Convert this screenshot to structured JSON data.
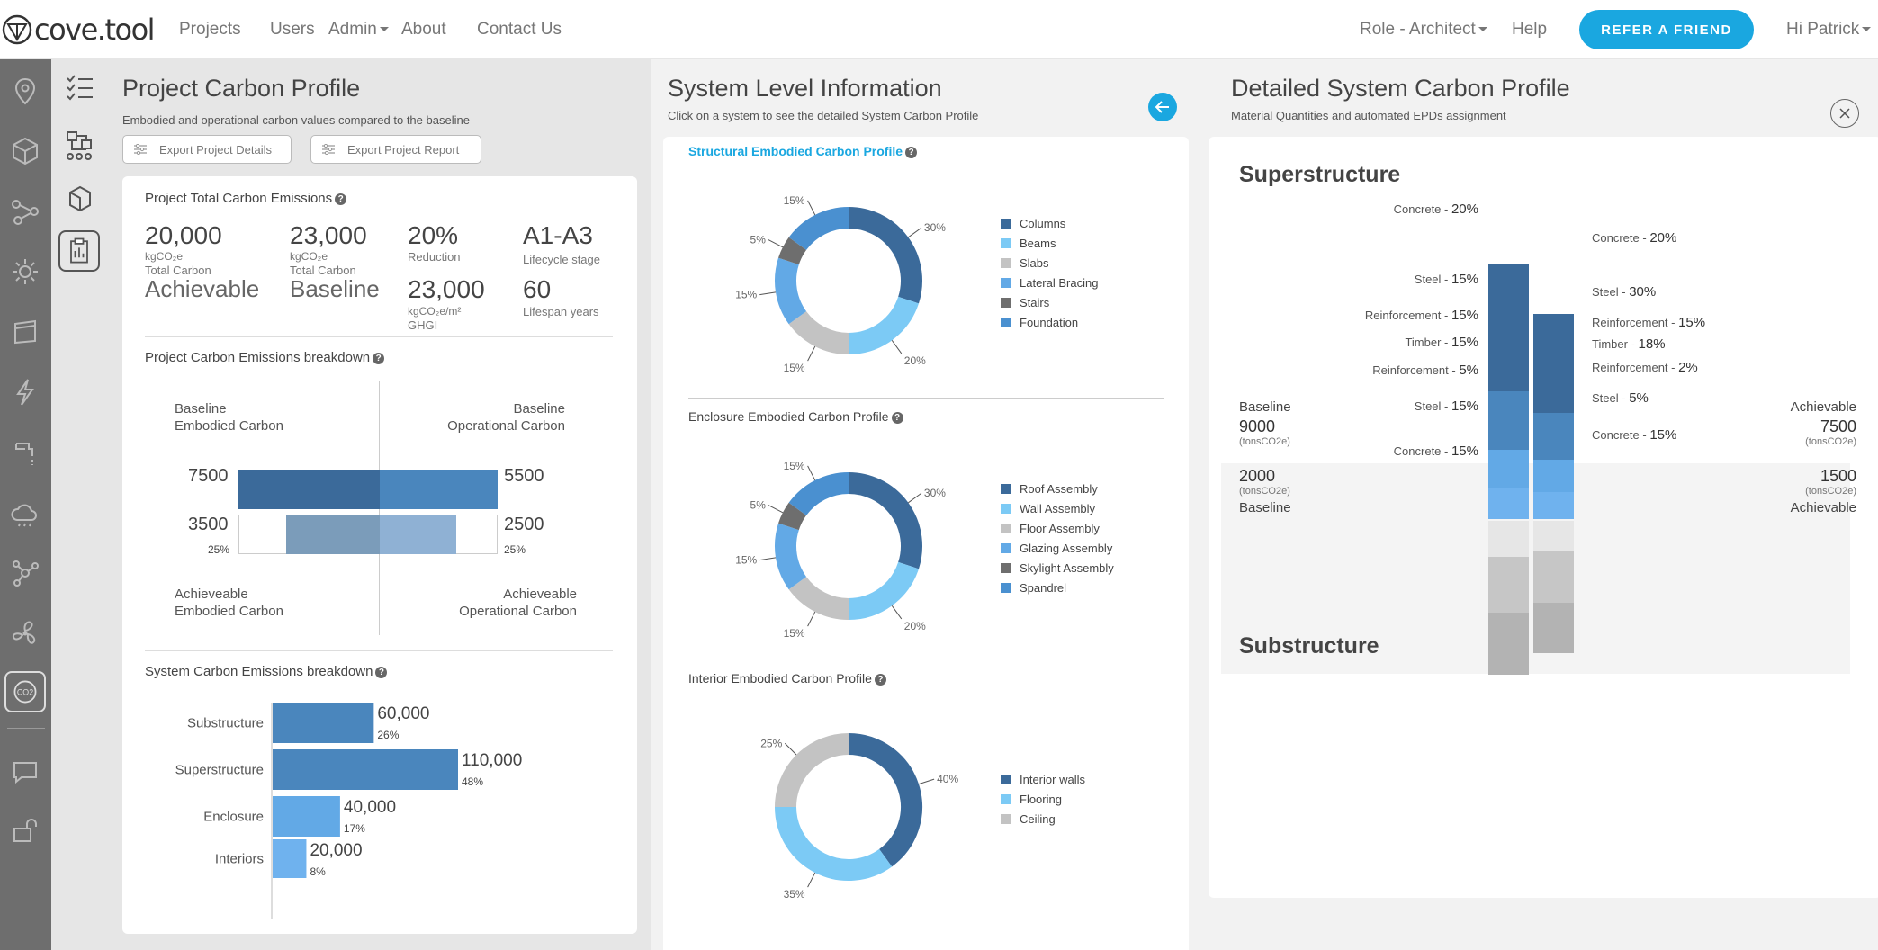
{
  "brand": {
    "logo_text": "cove.tool"
  },
  "nav": {
    "projects": "Projects",
    "users": "Users",
    "admin": "Admin",
    "about": "About",
    "contact": "Contact Us",
    "role": "Role - Architect",
    "help": "Help",
    "refer": "REFER A FRIEND",
    "greeting": "Hi Patrick"
  },
  "profile": {
    "title": "Project Carbon Profile",
    "subtitle": "Embodied and operational carbon values compared to the baseline",
    "export_details": "Export Project Details",
    "export_report": "Export Project Report",
    "total_title": "Project Total Carbon Emissions",
    "achievable_value": "20,000",
    "achievable_unit": "kgCO₂e",
    "achievable_sub": "Total Carbon",
    "achievable_label": "Achievable",
    "baseline_value": "23,000",
    "baseline_unit": "kgCO₂e",
    "baseline_sub": "Total Carbon",
    "baseline_label": "Baseline",
    "reduction_value": "20%",
    "reduction_label": "Reduction",
    "ghgi_value": "23,000",
    "ghgi_unit": "kgCO₂e/m²",
    "ghgi_label": "GHGI",
    "lifecycle_value": "A1-A3",
    "lifecycle_label": "Lifecycle stage",
    "lifespan_value": "60",
    "lifespan_label": "Lifespan years",
    "breakdown_title": "Project Carbon Emissions breakdown",
    "baseline_embodied_1": "Baseline",
    "baseline_embodied_2": "Embodied Carbon",
    "baseline_operational_1": "Baseline",
    "baseline_operational_2": "Operational Carbon",
    "achievable_embodied_1": "Achieveable",
    "achievable_embodied_2": "Embodied Carbon",
    "achievable_operational_1": "Achieveable",
    "achievable_operational_2": "Operational Carbon",
    "bl_embodied_num": "7500",
    "bl_operational_num": "5500",
    "ach_embodied_num": "3500",
    "ach_operational_num": "2500",
    "ach_embodied_pct": "25%",
    "ach_operational_pct": "25%",
    "system_title": "System Carbon Emissions breakdown"
  },
  "system_chart": {
    "type": "bar",
    "categories": [
      "Substructure",
      "Superstructure",
      "Enclosure",
      "Interiors"
    ],
    "values": [
      60000,
      110000,
      40000,
      20000
    ],
    "value_labels": [
      "60,000",
      "110,000",
      "40,000",
      "20,000"
    ],
    "pct_labels": [
      "26%",
      "48%",
      "17%",
      "8%"
    ],
    "colors": [
      "#4a86bd",
      "#4a86bd",
      "#62a9e6",
      "#6fb2ee"
    ]
  },
  "system_info": {
    "title": "System Level Information",
    "subtitle": "Click on a system to see the detailed System Carbon Profile",
    "structural_title": "Structural Embodied Carbon Profile",
    "enclosure_title": "Enclosure Embodied Carbon Profile",
    "interior_title": "Interior Embodied Carbon Profile"
  },
  "chart_data": [
    {
      "type": "pie",
      "title": "Structural Embodied Carbon Profile",
      "categories": [
        "Columns",
        "Beams",
        "Slabs",
        "Lateral Bracing",
        "Stairs",
        "Foundation"
      ],
      "values": [
        30,
        20,
        15,
        15,
        5,
        15
      ],
      "labels": [
        "30%",
        "20%",
        "15%",
        "15%",
        "5%",
        "15%"
      ],
      "colors": [
        "#3b6a9a",
        "#7ccaf5",
        "#c3c3c3",
        "#62a9e6",
        "#6e6e6e",
        "#4a90d0"
      ]
    },
    {
      "type": "pie",
      "title": "Enclosure Embodied Carbon Profile",
      "categories": [
        "Roof Assembly",
        "Wall Assembly",
        "Floor Assembly",
        "Glazing Assembly",
        "Skylight Assembly",
        "Spandrel"
      ],
      "values": [
        30,
        20,
        15,
        15,
        5,
        15
      ],
      "labels": [
        "30%",
        "20%",
        "15%",
        "15%",
        "5%",
        "15%"
      ],
      "colors": [
        "#3b6a9a",
        "#7ccaf5",
        "#c3c3c3",
        "#62a9e6",
        "#6e6e6e",
        "#4a90d0"
      ]
    },
    {
      "type": "pie",
      "title": "Interior Embodied Carbon Profile",
      "categories": [
        "Interior walls",
        "Flooring",
        "Ceiling"
      ],
      "values": [
        40,
        35,
        25
      ],
      "labels": [
        "40%",
        "35%",
        "25%"
      ],
      "colors": [
        "#3b6a9a",
        "#7ccaf5",
        "#c3c3c3"
      ]
    }
  ],
  "detail": {
    "title": "Detailed System Carbon Profile",
    "subtitle": "Material Quantities and automated EPDs assignment",
    "superstructure": "Superstructure",
    "substructure": "Substructure",
    "baseline_label": "Baseline",
    "baseline_value": "9000",
    "baseline_unit": "(tonsCO2e)",
    "achievable_label": "Achievable",
    "achievable_value": "7500",
    "achievable_unit": "(tonsCO2e)",
    "sub_baseline_value": "2000",
    "sub_baseline_unit": "(tonsCO2e)",
    "sub_baseline_label": "Baseline",
    "sub_achievable_value": "1500",
    "sub_achievable_unit": "(tonsCO2e)",
    "sub_achievable_label": "Achievable",
    "left_labels": [
      {
        "name": "Concrete - ",
        "pct": "20%"
      },
      {
        "name": "Steel - ",
        "pct": "15%"
      },
      {
        "name": "Reinforcement - ",
        "pct": "15%"
      },
      {
        "name": "Timber - ",
        "pct": "15%"
      },
      {
        "name": "Reinforcement - ",
        "pct": "5%"
      },
      {
        "name": "Steel - ",
        "pct": "15%"
      },
      {
        "name": "Concrete - ",
        "pct": "15%"
      }
    ],
    "right_labels": [
      {
        "name": "Concrete - ",
        "pct": "20%"
      },
      {
        "name": "Steel - ",
        "pct": "30%"
      },
      {
        "name": "Reinforcement - ",
        "pct": "15%"
      },
      {
        "name": "Timber - ",
        "pct": "18%"
      },
      {
        "name": "Reinforcement - ",
        "pct": "2%"
      },
      {
        "name": "Steel - ",
        "pct": "5%"
      },
      {
        "name": "Concrete - ",
        "pct": "15%"
      }
    ]
  }
}
